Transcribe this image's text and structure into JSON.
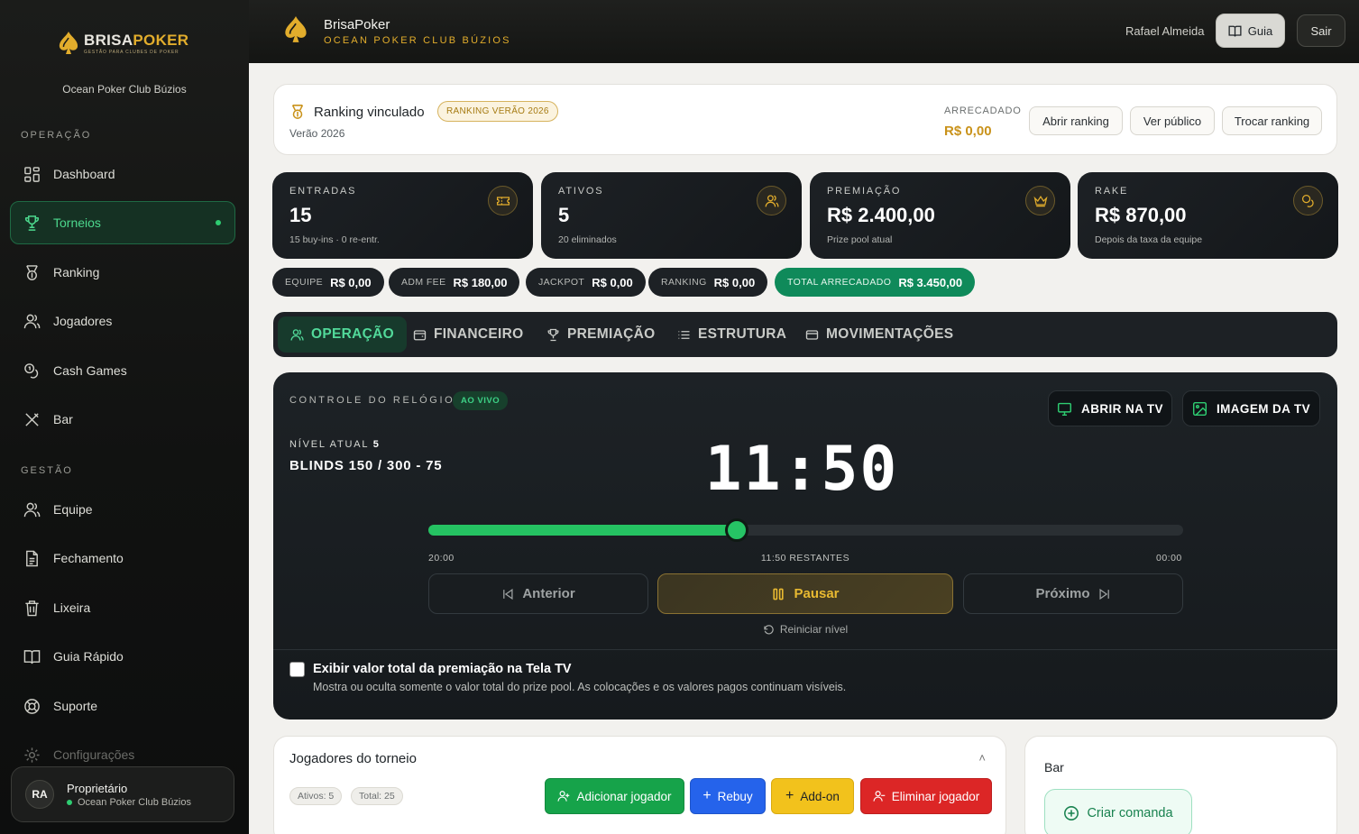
{
  "brand": {
    "logo_main": "BRISA",
    "logo_accent": "POKER",
    "logo_tagline": "GESTÃO PARA CLUBES DE POKER",
    "club_name": "Ocean Poker Club Búzios"
  },
  "sidebar": {
    "section_operacao": "OPERAÇÃO",
    "section_gestao": "GESTÃO",
    "items": [
      {
        "label": "Dashboard"
      },
      {
        "label": "Torneios"
      },
      {
        "label": "Ranking"
      },
      {
        "label": "Jogadores"
      },
      {
        "label": "Cash Games"
      },
      {
        "label": "Bar"
      },
      {
        "label": "Equipe"
      },
      {
        "label": "Fechamento"
      },
      {
        "label": "Lixeira"
      },
      {
        "label": "Guia Rápido"
      },
      {
        "label": "Suporte"
      },
      {
        "label": "Configurações"
      }
    ],
    "user": {
      "initials": "RA",
      "role": "Proprietário",
      "club": "Ocean Poker Club Búzios"
    }
  },
  "topbar": {
    "title": "BrisaPoker",
    "subtitle": "OCEAN POKER CLUB BÚZIOS",
    "user_name": "Rafael Almeida",
    "guide_label": "Guia",
    "logout_label": "Sair"
  },
  "ranking": {
    "title": "Ranking vinculado",
    "badge": "RANKING VERÃO 2026",
    "season": "Verão 2026",
    "collected_label": "ARRECADADO",
    "collected_value": "R$ 0,00",
    "btn_open": "Abrir ranking",
    "btn_public": "Ver público",
    "btn_switch": "Trocar ranking"
  },
  "stats": [
    {
      "label": "ENTRADAS",
      "value": "15",
      "sub": "15 buy-ins · 0 re-entr.",
      "icon": "ticket-icon"
    },
    {
      "label": "ATIVOS",
      "value": "5",
      "sub": "20 eliminados",
      "icon": "users-icon"
    },
    {
      "label": "PREMIAÇÃO",
      "value": "R$ 2.400,00",
      "sub": "Prize pool atual",
      "icon": "crown-icon"
    },
    {
      "label": "RAKE",
      "value": "R$ 870,00",
      "sub": "Depois da taxa da equipe",
      "icon": "coins-icon"
    }
  ],
  "pills": [
    {
      "label": "EQUIPE",
      "value": "R$ 0,00"
    },
    {
      "label": "ADM FEE",
      "value": "R$ 180,00"
    },
    {
      "label": "JACKPOT",
      "value": "R$ 0,00"
    },
    {
      "label": "RANKING",
      "value": "R$ 0,00"
    },
    {
      "label": "TOTAL ARRECADADO",
      "value": "R$ 3.450,00"
    }
  ],
  "tabs": [
    "OPERAÇÃO",
    "FINANCEIRO",
    "PREMIAÇÃO",
    "ESTRUTURA",
    "MOVIMENTAÇÕES"
  ],
  "clock": {
    "label": "CONTROLE DO RELÓGIO",
    "live": "AO VIVO",
    "open_tv": "ABRIR NA TV",
    "tv_image": "IMAGEM DA TV",
    "level_label": "NÍVEL ATUAL",
    "level": "5",
    "blinds": "BLINDS 150 / 300 - 75",
    "time": "11:50",
    "progress": 0.4083,
    "start": "20:00",
    "remaining": "11:50 RESTANTES",
    "end": "00:00",
    "prev": "Anterior",
    "pause": "Pausar",
    "next": "Próximo",
    "reset": "Reiniciar nível",
    "toggle_title": "Exibir valor total da premiação na Tela TV",
    "toggle_desc": "Mostra ou oculta somente o valor total do prize pool. As colocações e os valores pagos continuam visíveis."
  },
  "players": {
    "title": "Jogadores do torneio",
    "active_chip": "Ativos: 5",
    "total_chip": "Total: 25",
    "add": "Adicionar jogador",
    "rebuy": "Rebuy",
    "addon": "Add-on",
    "eliminate": "Eliminar jogador"
  },
  "bar": {
    "title": "Bar",
    "create": "Criar comanda"
  },
  "colors": {
    "accent_gold": "#e2ad2c",
    "accent_green": "#2ecc71",
    "dark_card": "#1d2125"
  }
}
